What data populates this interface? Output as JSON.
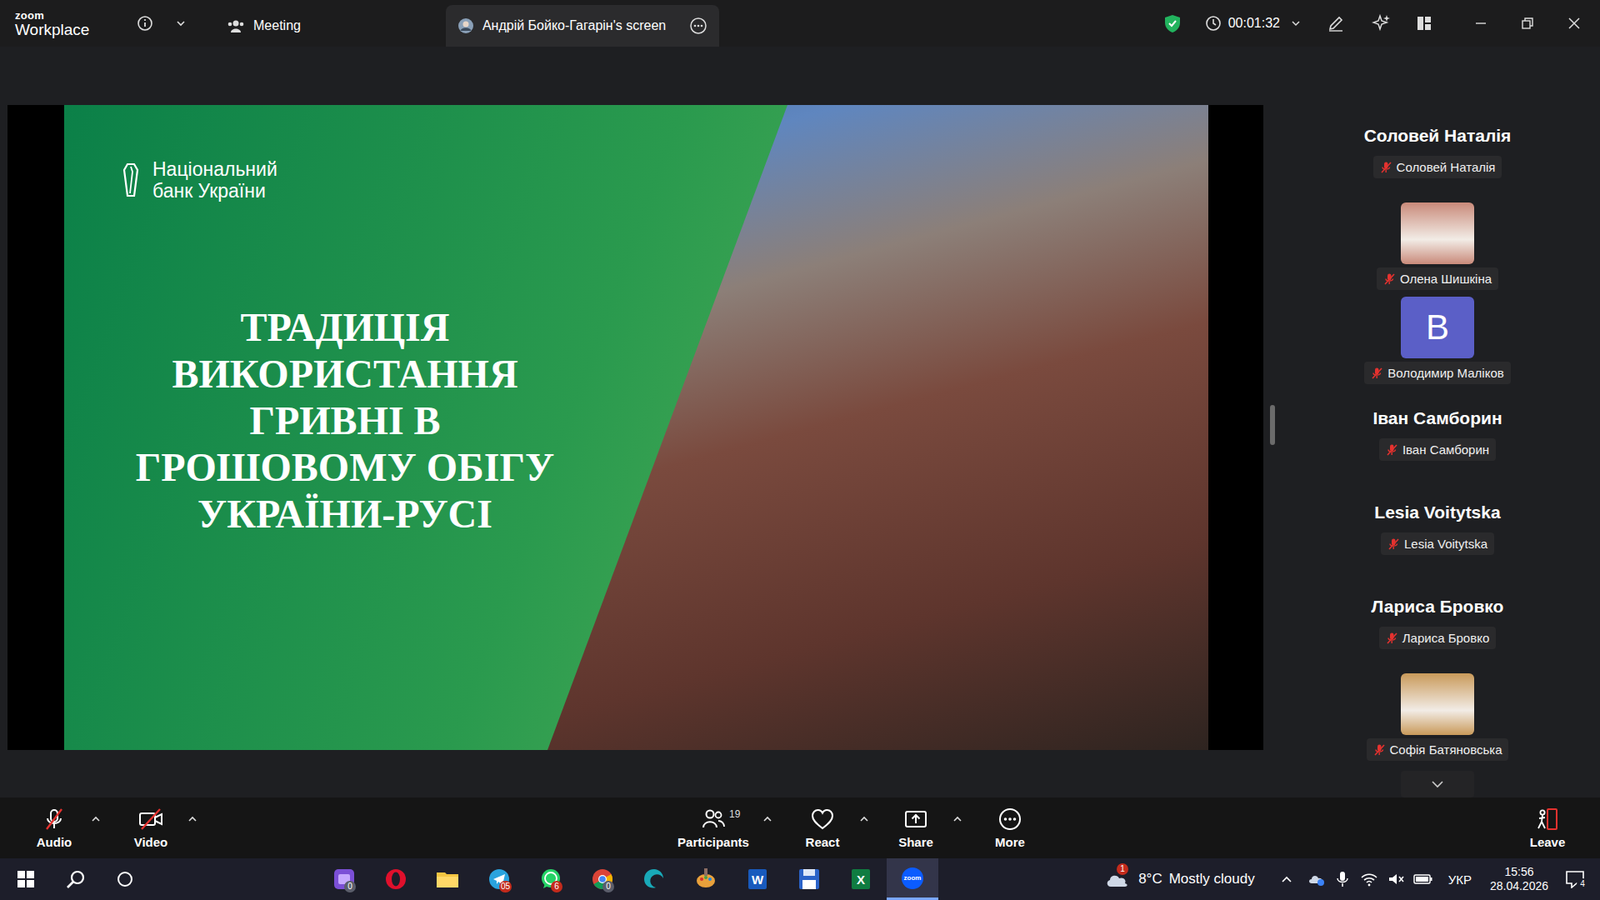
{
  "window": {
    "logo_top": "zoom",
    "logo_bottom": "Workplace"
  },
  "title_bar": {
    "tabs": [
      {
        "label": "Meeting",
        "selected": false,
        "kind": "meeting"
      },
      {
        "label": "Андрій Бойко-Гагарін's screen",
        "selected": true,
        "kind": "screen"
      }
    ],
    "timer": "00:01:32"
  },
  "shared_screen": {
    "slide": {
      "logo_lines": [
        "Національний",
        "банк України"
      ],
      "title_lines": [
        "ТРАДИЦІЯ",
        "ВИКОРИСТАННЯ",
        "ГРИВНІ В",
        "ГРОШОВОМУ ОБІГУ",
        "УКРАЇНИ-РУСІ"
      ]
    }
  },
  "participants": [
    {
      "name": "Соловей Наталія",
      "kind": "name",
      "muted": true
    },
    {
      "name": "Олена Шишкіна",
      "kind": "video",
      "muted": true,
      "color": "#c98a7a"
    },
    {
      "name": "Володимир Маліков",
      "kind": "avatar",
      "initial": "В",
      "muted": true,
      "color": "#5b5fc7"
    },
    {
      "name": "Іван Самборин",
      "kind": "name",
      "muted": true
    },
    {
      "name": "Lesia Voitytska",
      "kind": "name",
      "muted": true
    },
    {
      "name": "Лариса Бровко",
      "kind": "name",
      "muted": true
    },
    {
      "name": "Софія Батяновська",
      "kind": "video",
      "muted": true,
      "color": "#c99a5a"
    }
  ],
  "toolbar": {
    "buttons": [
      {
        "label": "Audio",
        "kind": "audio",
        "off": true
      },
      {
        "label": "Video",
        "kind": "video",
        "off": true
      },
      {
        "label": "Participants",
        "kind": "participants",
        "count": "19"
      },
      {
        "label": "React",
        "kind": "react"
      },
      {
        "label": "Share",
        "kind": "share"
      },
      {
        "label": "More",
        "kind": "more"
      },
      {
        "label": "Leave",
        "kind": "leave"
      }
    ]
  },
  "taskbar": {
    "apps": [
      {
        "kind": "clipchamp",
        "badge": "0",
        "active": false
      },
      {
        "kind": "opera",
        "active": false
      },
      {
        "kind": "explorer",
        "active": false
      },
      {
        "kind": "telegram",
        "badge": "05",
        "active": false
      },
      {
        "kind": "whatsapp",
        "badge": "6",
        "active": false
      },
      {
        "kind": "chrome",
        "badge": "0",
        "active": false
      },
      {
        "kind": "swirl",
        "active": false
      },
      {
        "kind": "paint",
        "active": false
      },
      {
        "kind": "word",
        "glyph": "W",
        "active": false
      },
      {
        "kind": "save",
        "active": false
      },
      {
        "kind": "excel",
        "glyph": "X",
        "active": false
      },
      {
        "kind": "zoom",
        "glyph": "zoom",
        "active": true
      }
    ],
    "weather": {
      "temp": "8°C",
      "condition": "Mostly cloudy",
      "badge": "1"
    },
    "language": "УКР",
    "time": "15:56",
    "date": "28.04.2026",
    "notifications": "4"
  }
}
